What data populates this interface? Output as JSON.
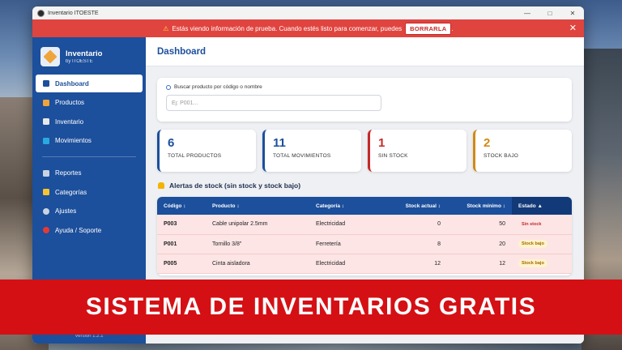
{
  "window": {
    "title": "Inventario ITOESTE"
  },
  "banner": {
    "message": "Estás viendo información de prueba. Cuando estés listo para comenzar, puedes",
    "button": "BORRARLA",
    "suffix": "."
  },
  "sidebar": {
    "brand_name": "Inventario",
    "brand_sub": "by ITOESTE",
    "items": [
      {
        "label": "Dashboard",
        "icon": "chart-icon",
        "color": "#1c4f9c"
      },
      {
        "label": "Productos",
        "icon": "box-icon",
        "color": "#f0a53a"
      },
      {
        "label": "Inventario",
        "icon": "clipboard-icon",
        "color": "#e8e8e8"
      },
      {
        "label": "Movimientos",
        "icon": "transfer-icon",
        "color": "#2aa9e0"
      },
      {
        "label": "Reportes",
        "icon": "report-icon",
        "color": "#c9d3e2"
      },
      {
        "label": "Categorías",
        "icon": "tag-icon",
        "color": "#f4c430"
      },
      {
        "label": "Ajustes",
        "icon": "gear-icon",
        "color": "#c9d3e2"
      },
      {
        "label": "Ayuda / Soporte",
        "icon": "help-icon",
        "color": "#e53935"
      }
    ],
    "version": "Versión 1.2.1"
  },
  "main": {
    "title": "Dashboard",
    "search": {
      "label": "Buscar producto por código o nombre",
      "placeholder": "Ej: P001..."
    },
    "stats": [
      {
        "value": "6",
        "label": "TOTAL PRODUCTOS",
        "color": "#1c4f9c"
      },
      {
        "value": "11",
        "label": "TOTAL MOVIMIENTOS",
        "color": "#1c4f9c"
      },
      {
        "value": "1",
        "label": "SIN STOCK",
        "color": "#c62828"
      },
      {
        "value": "2",
        "label": "STOCK BAJO",
        "color": "#d08a14"
      }
    ],
    "alerts_title": "Alertas de stock (sin stock y stock bajo)",
    "table": {
      "headers": [
        "Código ↕",
        "Producto ↕",
        "Categoría ↕",
        "Stock actual ↕",
        "Stock mínimo ↕",
        "Estado ▲"
      ],
      "rows": [
        [
          "P003",
          "Cable unipolar 2.5mm",
          "Electricidad",
          "0",
          "50",
          "Sin stock"
        ],
        [
          "P001",
          "Tornillo 3/8\"",
          "Ferretería",
          "8",
          "20",
          "Stock bajo"
        ],
        [
          "P005",
          "Cinta aisladora",
          "Electricidad",
          "12",
          "12",
          "Stock bajo"
        ]
      ]
    }
  },
  "promo": {
    "text": "SISTEMA DE INVENTARIOS GRATIS"
  }
}
